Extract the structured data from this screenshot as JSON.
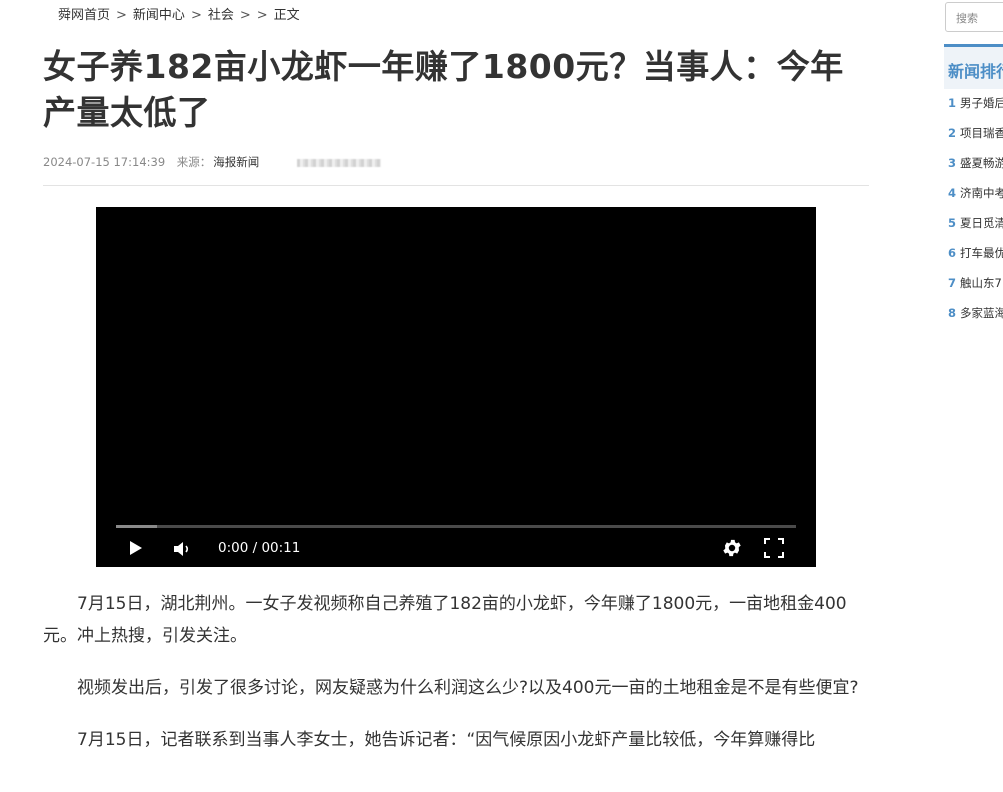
{
  "breadcrumb": {
    "items": [
      "舜网首页",
      "新闻中心",
      "社会",
      "",
      "正文"
    ],
    "separator": ">"
  },
  "article": {
    "title": "女子养182亩小龙虾一年赚了1800元？当事人：今年产量太低了",
    "date": "2024-07-15 17:14:39",
    "source_label": "来源：",
    "source": "海报新闻",
    "paragraphs": [
      "7月15日，湖北荆州。一女子发视频称自己养殖了182亩的小龙虾，今年赚了1800元，一亩地租金400元。冲上热搜，引发关注。",
      "视频发出后，引发了很多讨论，网友疑惑为什么利润这么少?以及400元一亩的土地租金是不是有些便宜?",
      "7月15日，记者联系到当事人李女士，她告诉记者：“因气候原因小龙虾产量比较低，今年算赚得比"
    ]
  },
  "video": {
    "time": "0:00 / 00:11",
    "progress": 0.06,
    "icons": {
      "play": "play-icon",
      "volume": "volume-icon",
      "settings": "gear-icon",
      "fullscreen": "fullscreen-icon"
    }
  },
  "sidebar": {
    "search_placeholder": "搜索",
    "rank_title": "新闻排行",
    "rank_items": [
      {
        "num": "1",
        "text": "男子婚后"
      },
      {
        "num": "2",
        "text": "项目瑞香"
      },
      {
        "num": "3",
        "text": "盛夏畅游"
      },
      {
        "num": "4",
        "text": "济南中考"
      },
      {
        "num": "5",
        "text": "夏日觅清"
      },
      {
        "num": "6",
        "text": "打车最优"
      },
      {
        "num": "7",
        "text": "触山东7"
      },
      {
        "num": "8",
        "text": "多家蓝海"
      }
    ]
  },
  "colors": {
    "accent": "#4d8ec6",
    "text": "#333333",
    "meta": "#888888",
    "video_bg": "#000000"
  }
}
